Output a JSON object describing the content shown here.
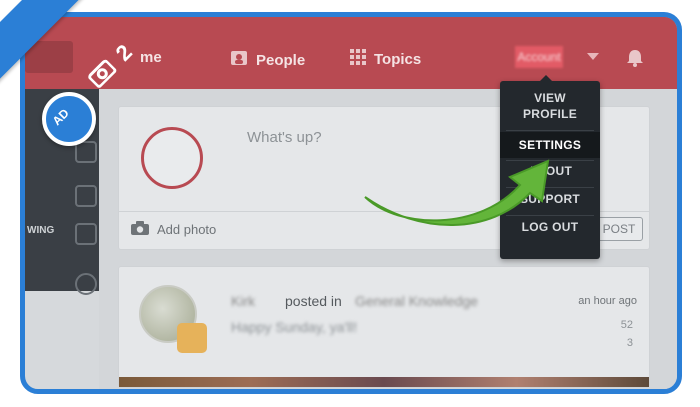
{
  "nav": {
    "home_partial": "me",
    "people": "People",
    "topics": "Topics",
    "username": "Account"
  },
  "sidebar": {
    "label": "WING"
  },
  "composer": {
    "placeholder": "What's up?",
    "add_photo": "Add photo",
    "post": "POST"
  },
  "post": {
    "author": "Kirk",
    "verb": "posted in",
    "topic": "General Knowledge",
    "time": "an hour ago",
    "text": "Happy Sunday, ya'll!",
    "likes": "52",
    "comments": "3"
  },
  "menu": {
    "view_profile_line1": "VIEW",
    "view_profile_line2": "PROFILE",
    "settings": "SETTINGS",
    "about": "ABOUT",
    "support": "SUPPORT",
    "logout": "LOG OUT"
  },
  "badge": {
    "step": "2",
    "ad_text": "AD"
  },
  "colors": {
    "frame": "#2b7fd6",
    "navbar": "#b84a52",
    "menu_bg": "#23282d",
    "arrow": "#63b53a"
  },
  "icons": [
    "people-icon",
    "topics-grid-icon",
    "bell-icon",
    "camera-icon",
    "settings-arrow-icon"
  ]
}
